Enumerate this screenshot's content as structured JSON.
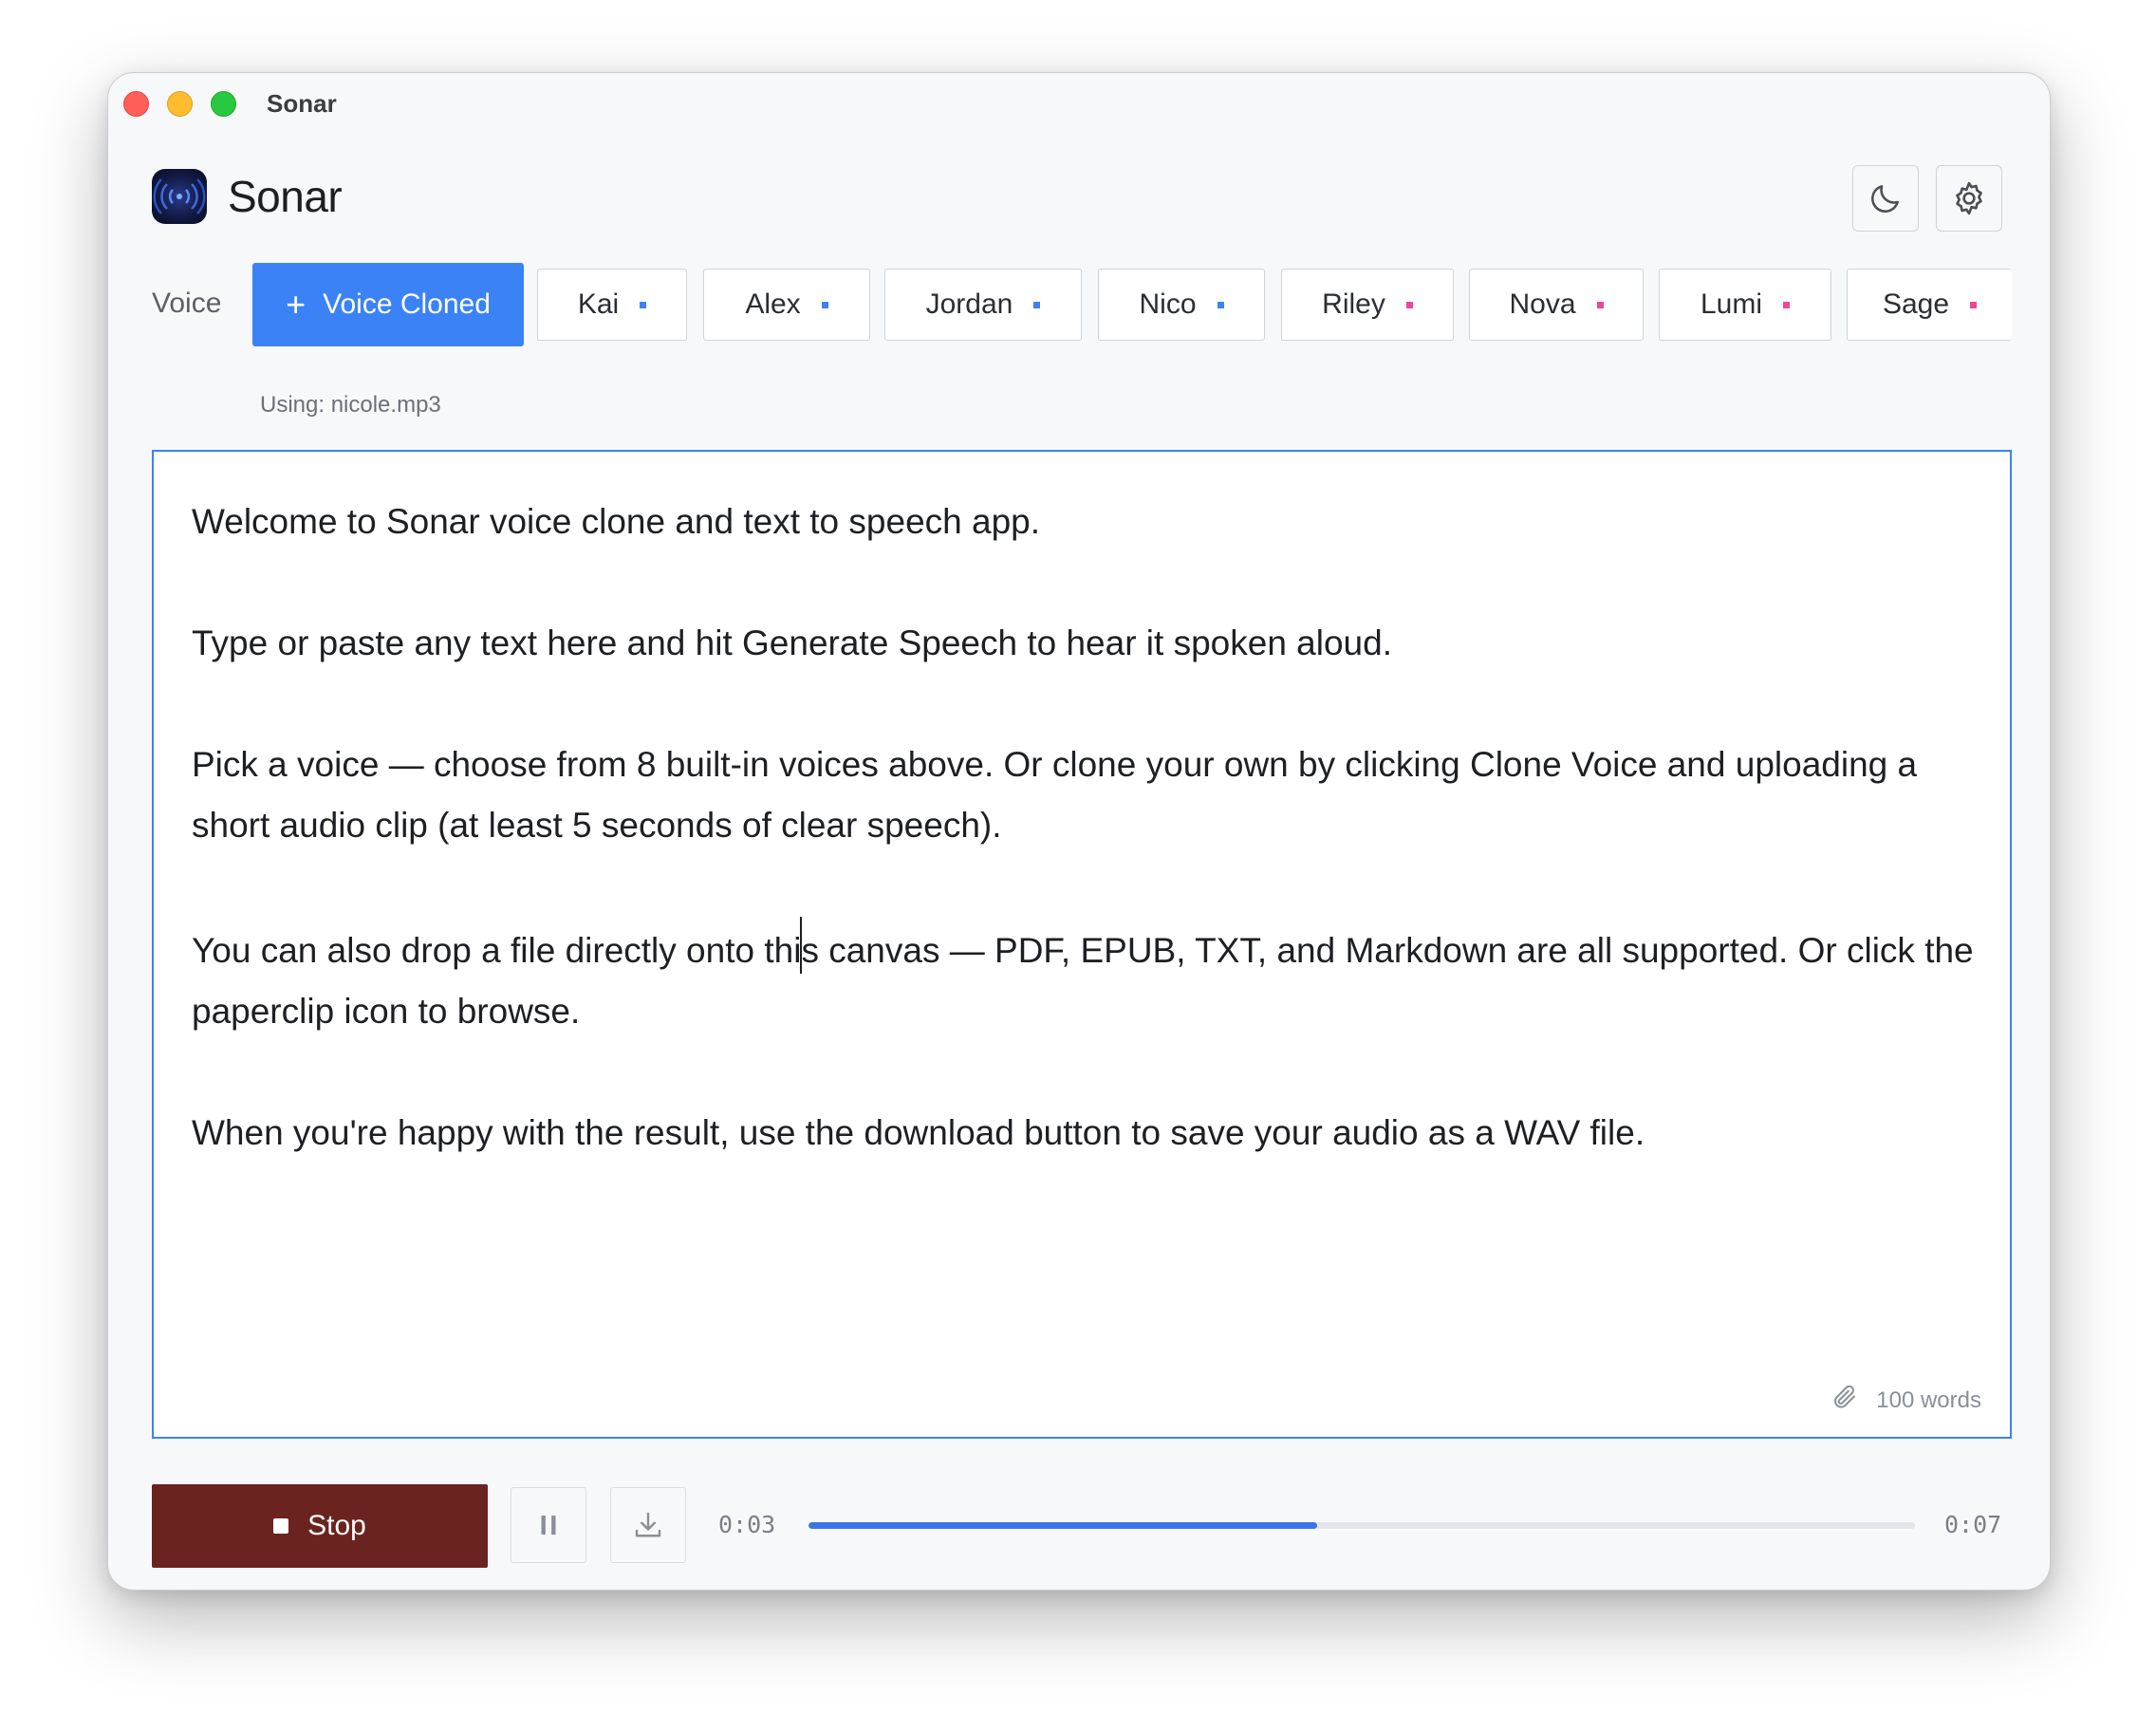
{
  "window": {
    "title": "Sonar"
  },
  "app": {
    "name": "Sonar",
    "logo_icon": "sound-wave-icon",
    "theme_icon": "moon-icon",
    "settings_icon": "gear-icon"
  },
  "voice": {
    "label": "Voice",
    "clone_button": "Voice Cloned",
    "using_text": "Using: nicole.mp3",
    "voices": [
      {
        "name": "Kai",
        "color": "#3b82f6"
      },
      {
        "name": "Alex",
        "color": "#3b82f6"
      },
      {
        "name": "Jordan",
        "color": "#3b82f6"
      },
      {
        "name": "Nico",
        "color": "#3b82f6"
      },
      {
        "name": "Riley",
        "color": "#ec4899"
      },
      {
        "name": "Nova",
        "color": "#ec4899"
      },
      {
        "name": "Lumi",
        "color": "#ec4899"
      },
      {
        "name": "Sage",
        "color": "#ec4899"
      }
    ]
  },
  "editor": {
    "paragraphs": [
      "Welcome to Sonar voice clone and text to speech app.",
      "Type or paste any text here and hit Generate Speech to hear it spoken aloud.",
      "Pick a voice — choose from 8 built-in voices above. Or  clone your own by clicking Clone Voice and uploading a short audio clip (at least 5 seconds of clear speech).",
      "You can also drop a file directly onto this canvas — PDF, EPUB, TXT, and Markdown are all supported. Or click the paperclip icon to browse.",
      "When you're happy with the result, use the download button to save your audio as a WAV file."
    ],
    "caret_para_before": "You can also drop a file directly onto thi",
    "caret_para_after": "s canvas — PDF, EPUB, TXT, and Markdown are all supported. Or click the paperclip icon to browse.",
    "word_count": "100 words",
    "attach_icon": "paperclip-icon"
  },
  "player": {
    "stop_label": "Stop",
    "current_time": "0:03",
    "total_time": "0:07",
    "progress": 0.46,
    "accent": "#3b74e6",
    "stop_color": "#6b231f"
  }
}
